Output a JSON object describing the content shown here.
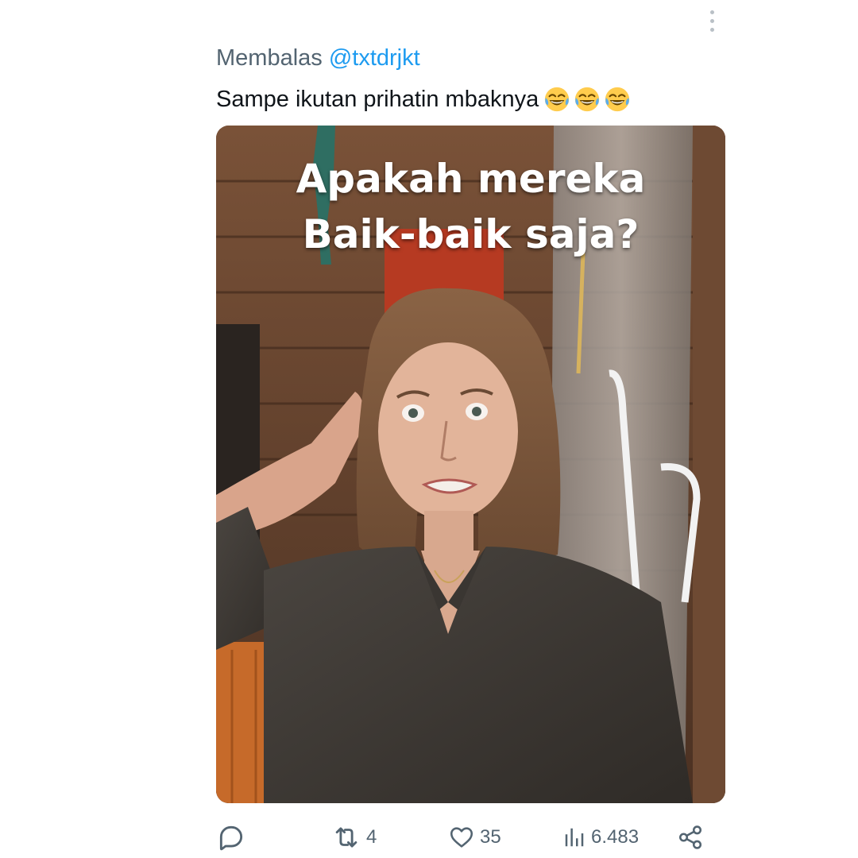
{
  "reply_context": {
    "prefix": "Membalas",
    "handle": "@txtdrjkt"
  },
  "tweet": {
    "text": "Sampe ikutan prihatin mbaknya",
    "emojis": [
      "face-with-tears-of-joy",
      "face-with-tears-of-joy",
      "face-with-tears-of-joy"
    ]
  },
  "media": {
    "caption_line1": "Apakah mereka",
    "caption_line2": "Baik-baik saja?"
  },
  "actions": {
    "reply_count": "",
    "retweet_count": "4",
    "like_count": "35",
    "views_count": "6.483"
  },
  "colors": {
    "secondary_text": "#536471",
    "link": "#1d9bf0",
    "primary_text": "#0f1419"
  }
}
